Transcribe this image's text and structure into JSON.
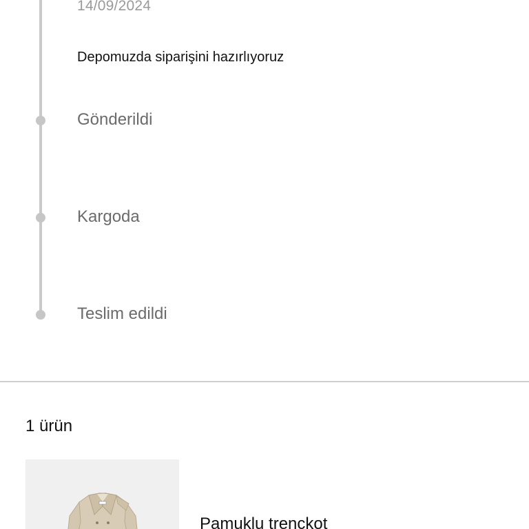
{
  "tracking": {
    "date": "14/09/2024",
    "current_description": "Depomuzda siparişini hazırlıyoruz",
    "steps": [
      {
        "label": "Gönderildi"
      },
      {
        "label": "Kargoda"
      },
      {
        "label": "Teslim edildi"
      }
    ]
  },
  "order_items": {
    "count_label": "1 ürün",
    "products": [
      {
        "name": "Pamuklu trençkot",
        "image_icon": "trench-coat-image"
      }
    ]
  },
  "colors": {
    "timeline": "#c9c9c9",
    "muted_text": "#6b6b6b",
    "image_background": "#f0f0f0"
  }
}
